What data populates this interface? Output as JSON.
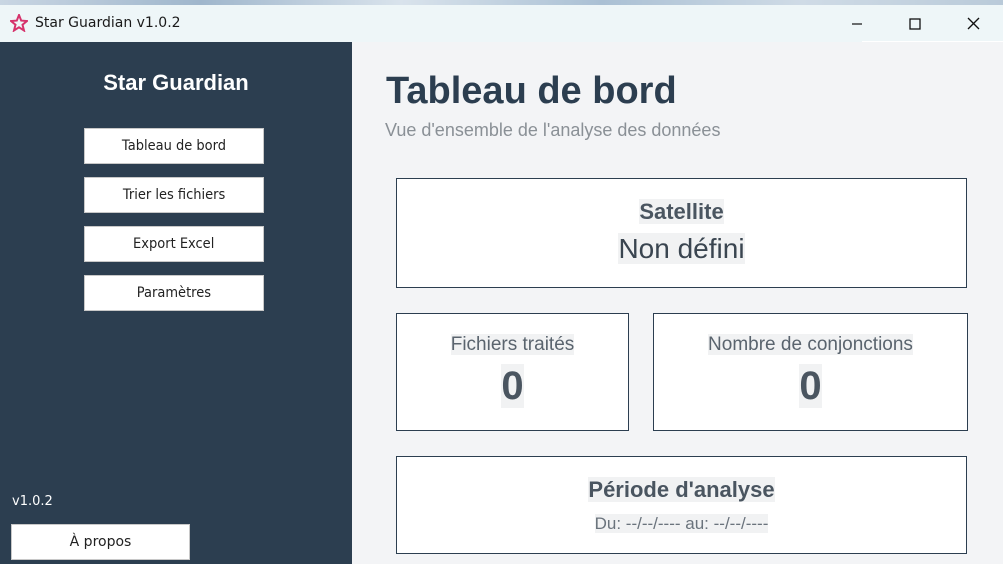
{
  "window": {
    "title": "Star Guardian v1.0.2",
    "controls": {
      "minimize_icon": "minimize-icon",
      "maximize_icon": "maximize-icon",
      "close_icon": "close-icon"
    }
  },
  "sidebar": {
    "brand": "Star Guardian",
    "items": [
      {
        "label": "Tableau de bord"
      },
      {
        "label": "Trier les fichiers"
      },
      {
        "label": "Export Excel"
      },
      {
        "label": "Paramètres"
      }
    ],
    "version": "v1.0.2",
    "about_label": "À propos"
  },
  "main": {
    "title": "Tableau de bord",
    "subtitle": "Vue d'ensemble de l'analyse des données",
    "satellite": {
      "label": "Satellite",
      "value": "Non défini"
    },
    "files": {
      "label": "Fichiers traités",
      "value": "0"
    },
    "conjunctions": {
      "label": "Nombre de conjonctions",
      "value": "0"
    },
    "period": {
      "label": "Période d'analyse",
      "range": "Du: --/--/---- au: --/--/----"
    }
  },
  "colors": {
    "sidebar_bg": "#2c3e50",
    "main_bg": "#f3f4f6",
    "title_color": "#2c3e50",
    "app_icon": "#d6336c"
  }
}
